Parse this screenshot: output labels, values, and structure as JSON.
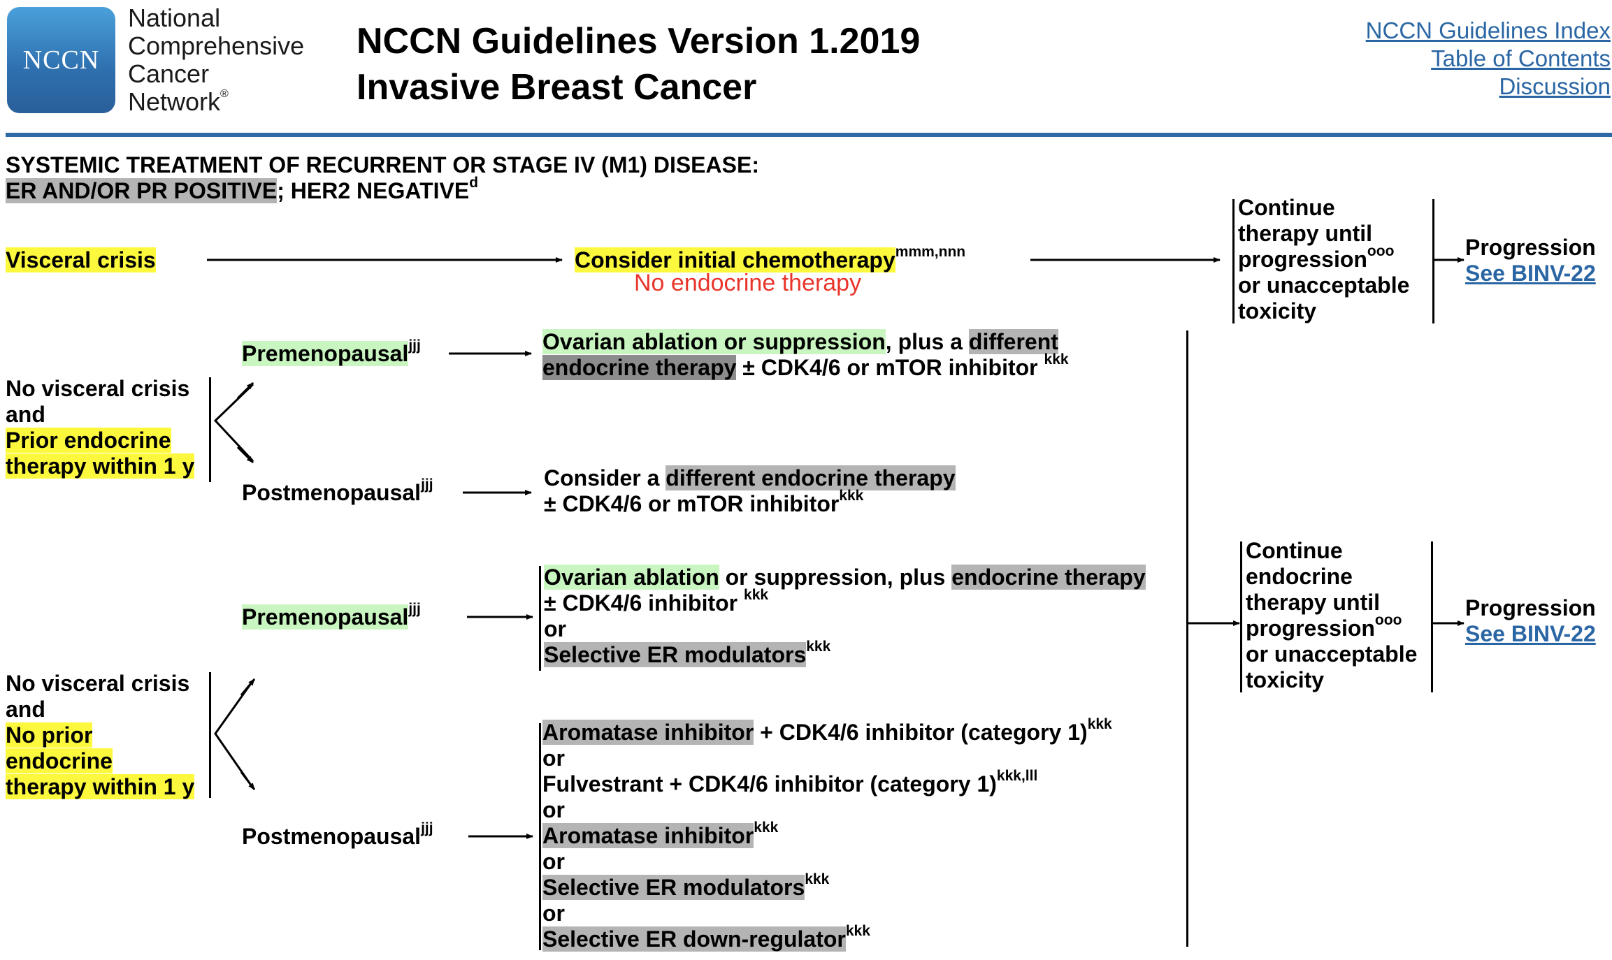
{
  "header": {
    "logo_mark": "NCCN",
    "org_lines": [
      "National",
      "Comprehensive",
      "Cancer",
      "Network"
    ],
    "registered_mark": "®",
    "title_line1": "NCCN Guidelines Version 1.2019",
    "title_line2": "Invasive Breast Cancer",
    "nav_links": [
      "NCCN Guidelines Index",
      "Table of Contents",
      "Discussion"
    ]
  },
  "section": {
    "line1": "SYSTEMIC TREATMENT OF RECURRENT OR STAGE IV (M1) DISEASE:",
    "line2_highlight": "ER AND/OR PR POSITIVE",
    "line2_rest": "; HER2 NEGATIVE",
    "line2_sup": "d"
  },
  "visceral": {
    "label": "Visceral crisis",
    "treatment": "Consider initial chemotherapy",
    "treatment_sup": "mmm,nnn",
    "note": "No endocrine therapy",
    "continue_lines": [
      "Continue",
      "therapy until",
      "progression",
      "or unacceptable",
      "toxicity"
    ],
    "continue_sup": "ooo",
    "progression": "Progression",
    "see_link": "See BINV-22"
  },
  "prior": {
    "condition_lines": [
      "No visceral crisis",
      "and"
    ],
    "condition_hl_lines": [
      "Prior endocrine",
      "therapy within 1 y"
    ],
    "pre_label": "Premenopausal",
    "pre_sup": "jjj",
    "pre_tx_hl_green": "Ovarian ablation or suppression",
    "pre_tx_mid": ", plus a ",
    "pre_tx_hl_gray1": "different",
    "pre_tx_hl_gray2": "endocrine therapy",
    "pre_tx_rest": " ± CDK4/6 or mTOR inhibitor ",
    "pre_tx_sup": "kkk",
    "post_label": "Postmenopausal",
    "post_sup": "jjj",
    "post_tx_a": "Consider a ",
    "post_tx_hl": "different endocrine therapy",
    "post_tx_line2": "± CDK4/6 or mTOR inhibitor",
    "post_tx_sup": "kkk"
  },
  "noprior": {
    "condition_lines": [
      "No visceral crisis",
      "and"
    ],
    "condition_hl_lines": [
      "No prior",
      "endocrine",
      "therapy within 1 y"
    ],
    "pre_label": "Premenopausal",
    "pre_sup": "jjj",
    "pre_l1_green": "Ovarian ablation",
    "pre_l1_mid": " or suppression, plus ",
    "pre_l1_gray": "endocrine therapy",
    "pre_l2": "± CDK4/6 inhibitor ",
    "pre_l2_sup": "kkk",
    "or": "or",
    "pre_l4_gray": "Selective ER modulators",
    "pre_l4_sup": "kkk",
    "post_label": "Postmenopausal",
    "post_sup": "jjj",
    "post_items": [
      {
        "hl": "Aromatase inhibitor",
        "rest": " + CDK4/6 inhibitor (category 1)",
        "sup": "kkk"
      },
      {
        "hl": "",
        "rest": "Fulvestrant + CDK4/6 inhibitor (category 1)",
        "sup": "kkk,lll"
      },
      {
        "hl": "Aromatase inhibitor",
        "rest": "",
        "sup": "kkk"
      },
      {
        "hl": "Selective ER modulators",
        "rest": "",
        "sup": "kkk"
      },
      {
        "hl": "Selective ER down-regulator",
        "rest": "",
        "sup": "kkk"
      }
    ],
    "continue_lines": [
      "Continue",
      "endocrine",
      "therapy until",
      "progression",
      "or unacceptable",
      "toxicity"
    ],
    "continue_sup": "ooo",
    "progression": "Progression",
    "see_link": "See BINV-22"
  }
}
